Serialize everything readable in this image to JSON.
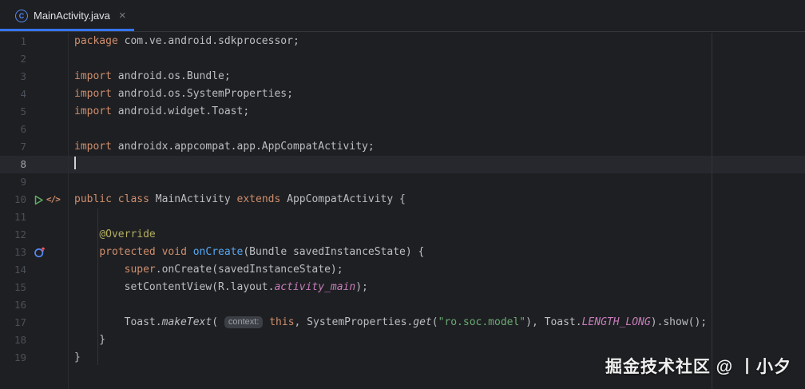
{
  "colors": {
    "editor_background": "#1E1F22",
    "caret_line_background": "#26282E",
    "accent_blue": "#3574F0",
    "keyword_orange": "#CF8E6D",
    "default_text": "#BCBEC4",
    "annotation_yellow": "#B3AE60",
    "method_declaration_blue": "#56A8F5",
    "string_green": "#6AAB73",
    "constant_purple": "#C77DBB",
    "line_number_gray": "#4B5059",
    "run_icon_green": "#5FAD65",
    "class_icon_blue": "#548AF7",
    "override_arrow_red": "#F75464"
  },
  "tab_bar": {
    "tabs": [
      {
        "title": "MainActivity.java",
        "icon": "java-class-icon",
        "icon_letter": "C",
        "close_glyph": "×",
        "active": true
      }
    ]
  },
  "editor": {
    "active_line": 8,
    "caret_visible": true,
    "lines": [
      {
        "num": "1",
        "tokens": [
          [
            "kw",
            "package"
          ],
          [
            "def",
            " com.ve.android.sdkprocessor;"
          ]
        ]
      },
      {
        "num": "2",
        "tokens": []
      },
      {
        "num": "3",
        "tokens": [
          [
            "kw",
            "import"
          ],
          [
            "def",
            " android.os.Bundle;"
          ]
        ]
      },
      {
        "num": "4",
        "tokens": [
          [
            "kw",
            "import"
          ],
          [
            "def",
            " android.os.SystemProperties;"
          ]
        ]
      },
      {
        "num": "5",
        "tokens": [
          [
            "kw",
            "import"
          ],
          [
            "def",
            " android.widget.Toast;"
          ]
        ]
      },
      {
        "num": "6",
        "tokens": []
      },
      {
        "num": "7",
        "tokens": [
          [
            "kw",
            "import"
          ],
          [
            "def",
            " androidx.appcompat.app.AppCompatActivity;"
          ]
        ]
      },
      {
        "num": "8",
        "tokens": []
      },
      {
        "num": "9",
        "tokens": []
      },
      {
        "num": "10",
        "gutter": [
          "run-icon",
          "code-tag-icon"
        ],
        "tokens": [
          [
            "kw",
            "public"
          ],
          [
            "def",
            " "
          ],
          [
            "kw",
            "class"
          ],
          [
            "def",
            " MainActivity "
          ],
          [
            "kw",
            "extends"
          ],
          [
            "def",
            " AppCompatActivity {"
          ]
        ]
      },
      {
        "num": "11",
        "tokens": []
      },
      {
        "num": "12",
        "tokens": [
          [
            "def",
            "    "
          ],
          [
            "ann",
            "@Override"
          ]
        ]
      },
      {
        "num": "13",
        "gutter": [
          "override-icon"
        ],
        "tokens": [
          [
            "def",
            "    "
          ],
          [
            "kw",
            "protected"
          ],
          [
            "def",
            " "
          ],
          [
            "kw",
            "void"
          ],
          [
            "def",
            " "
          ],
          [
            "mth",
            "onCreate"
          ],
          [
            "def",
            "(Bundle savedInstanceState) {"
          ]
        ]
      },
      {
        "num": "14",
        "tokens": [
          [
            "def",
            "        "
          ],
          [
            "kw",
            "super"
          ],
          [
            "def",
            ".onCreate(savedInstanceState);"
          ]
        ]
      },
      {
        "num": "15",
        "tokens": [
          [
            "def",
            "        setContentView(R.layout."
          ],
          [
            "con",
            "activity_main"
          ],
          [
            "def",
            ");"
          ]
        ]
      },
      {
        "num": "16",
        "tokens": []
      },
      {
        "num": "17",
        "tokens": [
          [
            "def",
            "        Toast."
          ],
          [
            "sm",
            "makeText"
          ],
          [
            "def",
            "( "
          ],
          [
            "inlay",
            "context:"
          ],
          [
            "def",
            " "
          ],
          [
            "kw",
            "this"
          ],
          [
            "def",
            ", SystemProperties."
          ],
          [
            "sm",
            "get"
          ],
          [
            "def",
            "("
          ],
          [
            "str",
            "\"ro.soc.model\""
          ],
          [
            "def",
            "), Toast."
          ],
          [
            "con",
            "LENGTH_LONG"
          ],
          [
            "def",
            ").show();"
          ]
        ]
      },
      {
        "num": "18",
        "tokens": [
          [
            "def",
            "    }"
          ]
        ]
      },
      {
        "num": "19",
        "tokens": [
          [
            "def",
            "}"
          ]
        ]
      }
    ]
  },
  "watermark": {
    "text": "掘金技术社区 @ 丨小夕"
  }
}
